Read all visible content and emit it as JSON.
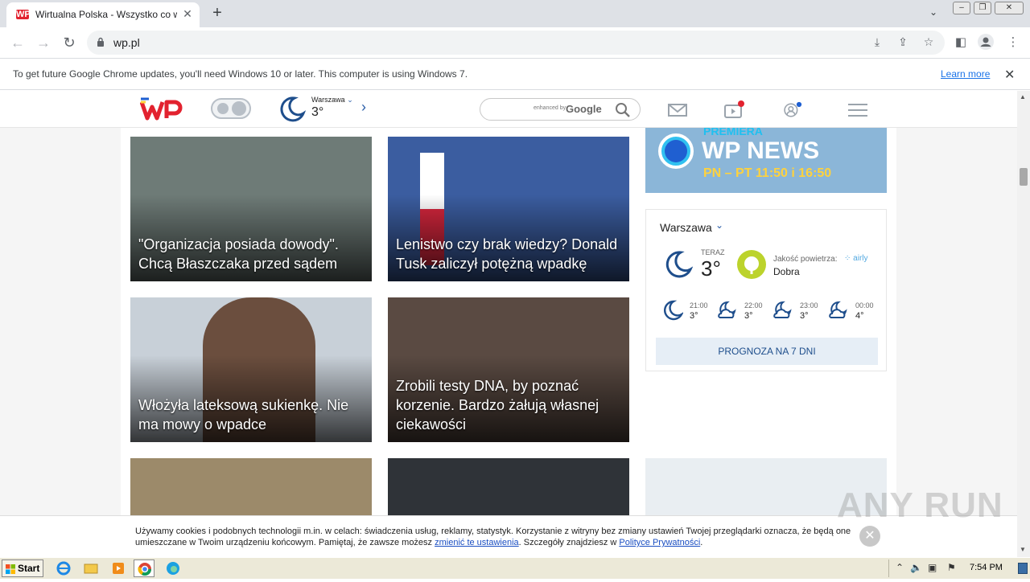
{
  "browser": {
    "tab_title": "Wirtualna Polska - Wszystko co waż",
    "favicon_text": "WP",
    "url": "wp.pl",
    "infobar_message": "To get future Google Chrome updates, you'll need Windows 10 or later. This computer is using Windows 7.",
    "infobar_link": "Learn more"
  },
  "header": {
    "weather_city": "Warszawa",
    "weather_temp": "3°",
    "search_enhanced": "enhanced by",
    "search_google": "Google"
  },
  "tiles": [
    {
      "caption": "\"Organizacja posiada dowody\". Chcą Błaszczaka przed sądem",
      "bg": "#6e7b77"
    },
    {
      "caption": "Lenistwo czy brak wiedzy? Donald Tusk zaliczył potężną wpadkę",
      "bg": "#3b5da0"
    },
    {
      "caption": "Włożyła lateksową sukienkę. Nie ma mowy o wpadce",
      "bg": "#c8d0d8"
    },
    {
      "caption": "Zrobili testy DNA, by poznać korzenie. Bardzo żałują własnej ciekawości",
      "bg": "#5a4a42"
    }
  ],
  "wpnews": {
    "premiere": "PREMIERA",
    "name": "WP NEWS",
    "hours": "PN – PT 11:50 i 16:50"
  },
  "weather": {
    "city": "Warszawa",
    "now_label": "TERAZ",
    "now_temp": "3°",
    "aq_label": "Jakość powietrza:",
    "aq_value": "Dobra",
    "aq_brand": "airly",
    "forecast": [
      {
        "time": "21:00",
        "temp": "3°"
      },
      {
        "time": "22:00",
        "temp": "3°"
      },
      {
        "time": "23:00",
        "temp": "3°"
      },
      {
        "time": "00:00",
        "temp": "4°"
      }
    ],
    "button": "PROGNOZA NA 7 DNI"
  },
  "cookie": {
    "text_1": "Używamy cookies i podobnych technologii m.in. w celach: świadczenia usług, reklamy, statystyk. Korzystanie z witryny bez zmiany ustawień Twojej przeglądarki oznacza, że będą one umieszczane w Twoim urządzeniu końcowym. Pamiętaj, że zawsze możesz ",
    "link_1": "zmienić te ustawienia",
    "text_2": ". Szczegóły znajdziesz w ",
    "link_2": "Polityce Prywatności",
    "text_3": "."
  },
  "watermark": "ANY RUN",
  "taskbar": {
    "start": "Start",
    "clock": "7:54 PM"
  },
  "colors": {
    "wp_red": "#e2222f",
    "accent_blue": "#1e4e8c",
    "aq_good": "#bcd32c"
  }
}
